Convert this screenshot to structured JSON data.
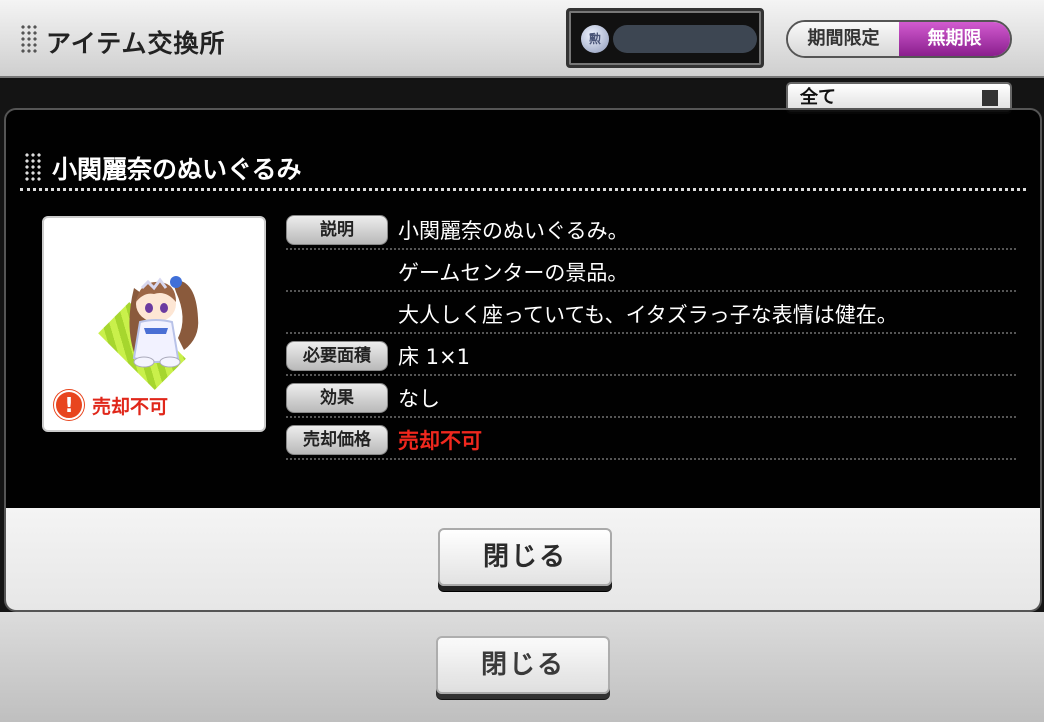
{
  "header": {
    "title": "アイテム交換所",
    "medal_icon_label": "勲",
    "period_tabs": {
      "limited": "期間限定",
      "unlimited": "無期限"
    }
  },
  "filter": {
    "selected": "全て"
  },
  "footer": {
    "close_label": "閉じる"
  },
  "modal": {
    "title": "小関麗奈のぬいぐるみ",
    "warning_icon": "!",
    "no_sale_text": "売却不可",
    "rows": [
      {
        "label": "説明",
        "value": "小関麗奈のぬいぐるみ。"
      },
      {
        "label": "",
        "value": "ゲームセンターの景品。"
      },
      {
        "label": "",
        "value": "大人しく座っていても、イタズラっ子な表情は健在。"
      },
      {
        "label": "必要面積",
        "value": "床 1×1"
      },
      {
        "label": "効果",
        "value": "なし"
      },
      {
        "label": "売却価格",
        "value": "売却不可"
      }
    ],
    "close_label": "閉じる"
  },
  "colors": {
    "accent_purple": "#8a1f8d",
    "warning_red": "#e0271a"
  },
  "icons": {
    "medal": "medal-coin-icon",
    "warning": "warning-icon",
    "dots": "grip-dots-icon",
    "doll": "doll-icon"
  }
}
